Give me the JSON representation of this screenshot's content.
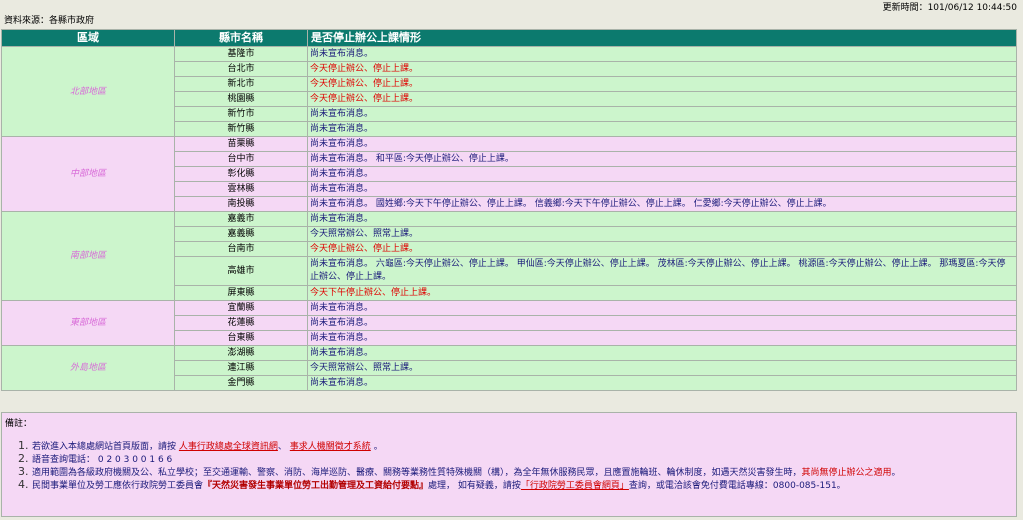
{
  "header": {
    "update_time": "更新時間：101/06/12 10:44:50",
    "source": "資料來源：各縣市政府"
  },
  "columns": [
    "區域",
    "縣市名稱",
    "是否停止辦公上課情形"
  ],
  "regions": [
    {
      "name": "北部地區",
      "rows": [
        {
          "county": "基隆市",
          "status": "尚未宣布消息。",
          "red": false
        },
        {
          "county": "台北市",
          "status": "今天停止辦公、停止上課。",
          "red": true
        },
        {
          "county": "新北市",
          "status": "今天停止辦公、停止上課。",
          "red": true
        },
        {
          "county": "桃園縣",
          "status": "今天停止辦公、停止上課。",
          "red": true
        },
        {
          "county": "新竹市",
          "status": "尚未宣布消息。",
          "red": false
        },
        {
          "county": "新竹縣",
          "status": "尚未宣布消息。",
          "red": false
        }
      ]
    },
    {
      "name": "中部地區",
      "rows": [
        {
          "county": "苗栗縣",
          "status": "尚未宣布消息。",
          "red": false
        },
        {
          "county": "台中市",
          "status": "尚未宣布消息。 和平區:今天停止辦公、停止上課。",
          "red": false
        },
        {
          "county": "彰化縣",
          "status": "尚未宣布消息。",
          "red": false
        },
        {
          "county": "雲林縣",
          "status": "尚未宣布消息。",
          "red": false
        },
        {
          "county": "南投縣",
          "status": "尚未宣布消息。 國姓鄉:今天下午停止辦公、停止上課。 信義鄉:今天下午停止辦公、停止上課。 仁愛鄉:今天停止辦公、停止上課。",
          "red": false
        }
      ]
    },
    {
      "name": "南部地區",
      "rows": [
        {
          "county": "嘉義市",
          "status": "尚未宣布消息。",
          "red": false
        },
        {
          "county": "嘉義縣",
          "status": "今天照常辦公、照常上課。",
          "red": false
        },
        {
          "county": "台南市",
          "status": "今天停止辦公、停止上課。",
          "red": true
        },
        {
          "county": "高雄市",
          "status": "尚未宣布消息。 六龜區:今天停止辦公、停止上課。 甲仙區:今天停止辦公、停止上課。 茂林區:今天停止辦公、停止上課。 桃源區:今天停止辦公、停止上課。 那瑪夏區:今天停止辦公、停止上課。",
          "red": false,
          "tall": true
        },
        {
          "county": "屏東縣",
          "status": "今天下午停止辦公、停止上課。",
          "red": true
        }
      ]
    },
    {
      "name": "東部地區",
      "rows": [
        {
          "county": "宜蘭縣",
          "status": "尚未宣布消息。",
          "red": false
        },
        {
          "county": "花蓮縣",
          "status": "尚未宣布消息。",
          "red": false
        },
        {
          "county": "台東縣",
          "status": "尚未宣布消息。",
          "red": false
        }
      ]
    },
    {
      "name": "外島地區",
      "rows": [
        {
          "county": "澎湖縣",
          "status": "尚未宣布消息。",
          "red": false
        },
        {
          "county": "連江縣",
          "status": "今天照常辦公、照常上課。",
          "red": false
        },
        {
          "county": "金門縣",
          "status": "尚未宣布消息。",
          "red": false
        }
      ]
    }
  ],
  "notes": {
    "title": "備註：",
    "n1_pre": "若欲進入本總處網站首頁版面，請按",
    "n1_link1": "人事行政總處全球資訊網",
    "n1_sep": "、",
    "n1_link2": "事求人機關徵才系統",
    "n1_post": "。",
    "n2": "語音查詢電話： 0 2 0 3 0 0 1 6 6",
    "n3_pre": "適用範圍為各級政府機關及公、私立學校；至交通運輸、警察、消防、海岸巡防、醫療、關務等業務性質特殊機關（構），為全年無休服務民眾，且應置施輪班、輪休制度，如遇天然災害發生時，",
    "n3_red": "其尚無停止辦公之適用",
    "n3_post": "。",
    "n4_pre": "民間事業單位及勞工應依行政院勞工委員會",
    "n4_bold": "『天然災害發生事業單位勞工出勤管理及工資給付要點』",
    "n4_mid": "處理， 如有疑義，請按",
    "n4_link": "「行政院勞工委員會網頁」",
    "n4_post": "查詢，或電洽該會免付費電話專線：0800-085-151。"
  }
}
